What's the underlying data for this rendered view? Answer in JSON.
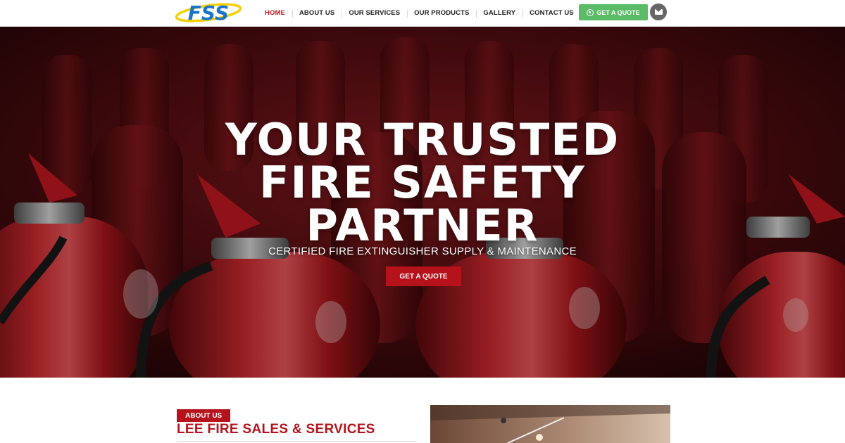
{
  "header": {
    "logo_text": "FSS",
    "nav": [
      {
        "label": "HOME",
        "active": true
      },
      {
        "label": "ABOUT US",
        "active": false
      },
      {
        "label": "OUR SERVICES",
        "active": false
      },
      {
        "label": "OUR PRODUCTS",
        "active": false
      },
      {
        "label": "GALLERY",
        "active": false
      },
      {
        "label": "CONTACT US",
        "active": false
      }
    ],
    "quote_button": "GET A QUOTE",
    "quote_icon": "whatsapp-icon",
    "mail_icon": "envelope-icon"
  },
  "hero": {
    "title_lines": [
      "YOUR TRUSTED",
      "FIRE SAFETY",
      "PARTNER"
    ],
    "subtitle": "CERTIFIED FIRE EXTINGUISHER SUPPLY & MAINTENANCE",
    "button": "GET A QUOTE"
  },
  "about": {
    "badge": "ABOUT US",
    "title": "LEE FIRE SALES & SERVICES"
  },
  "colors": {
    "brand_red": "#b5121b",
    "nav_active": "#c8181e",
    "whatsapp_green": "#5cbb66",
    "logo_blue": "#1a75c9",
    "logo_yellow": "#f5d000"
  }
}
